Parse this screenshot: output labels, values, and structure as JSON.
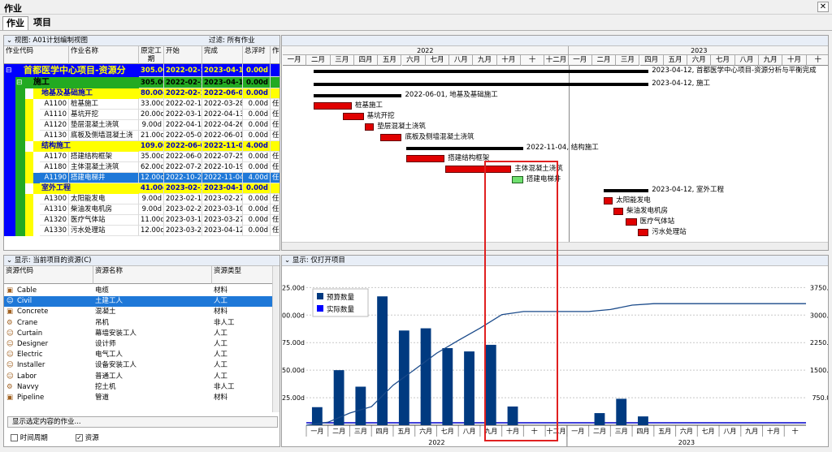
{
  "window": {
    "title": "作业",
    "close": "✕"
  },
  "tabs": [
    {
      "label": "作业"
    },
    {
      "label": "项目"
    }
  ],
  "activities": {
    "header": "视图: A01计划编制视图",
    "filter": "过滤: 所有作业",
    "columns": [
      "作业代码",
      "作业名称",
      "原定工期",
      "开始",
      "完成",
      "总浮时",
      "作"
    ],
    "rows": [
      {
        "kind": "project",
        "code": "首都医学中心项目-资源分",
        "name": "",
        "dur": "305.00d",
        "start": "2022-02-10",
        "finish": "2023-04-12",
        "float": "0.00d",
        "extra": ""
      },
      {
        "kind": "wbs1",
        "code": "",
        "name": "施工",
        "dur": "305.00d",
        "start": "2022-02-10",
        "finish": "2023-04-12",
        "float": "0.00d",
        "extra": ""
      },
      {
        "kind": "wbs2",
        "code": "",
        "name": "地基及基础施工",
        "dur": "80.00d",
        "start": "2022-02-10",
        "finish": "2022-06-01",
        "float": "0.00d",
        "extra": ""
      },
      {
        "kind": "task",
        "code": "A1100",
        "name": "桩基施工",
        "dur": "33.00d",
        "start": "2022-02-10",
        "finish": "2022-03-28",
        "float": "0.00d",
        "extra": "任:"
      },
      {
        "kind": "task",
        "code": "A1110",
        "name": "基坑开挖",
        "dur": "20.00d",
        "start": "2022-03-17",
        "finish": "2022-04-13",
        "float": "0.00d",
        "extra": "任:"
      },
      {
        "kind": "task",
        "code": "A1120",
        "name": "垫层混凝土浇筑",
        "dur": "9.00d",
        "start": "2022-04-14",
        "finish": "2022-04-26",
        "float": "0.00d",
        "extra": "任:"
      },
      {
        "kind": "task",
        "code": "A1130",
        "name": "底板及侧墙混凝土浇",
        "dur": "21.00d",
        "start": "2022-05-04",
        "finish": "2022-06-01",
        "float": "0.00d",
        "extra": "任:"
      },
      {
        "kind": "wbs2",
        "code": "",
        "name": "结构施工",
        "dur": "109.00d",
        "start": "2022-06-07",
        "finish": "2022-11-04",
        "float": "4.00d",
        "extra": ""
      },
      {
        "kind": "task",
        "code": "A1170",
        "name": "搭建结构框架",
        "dur": "35.00d",
        "start": "2022-06-07",
        "finish": "2022-07-25",
        "float": "0.00d",
        "extra": "任:"
      },
      {
        "kind": "task",
        "code": "A1180",
        "name": "主体混凝土浇筑",
        "dur": "62.00d",
        "start": "2022-07-26",
        "finish": "2022-10-19",
        "float": "0.00d",
        "extra": "任:"
      },
      {
        "kind": "selected",
        "code": "A1190",
        "name": "搭建电梯井",
        "dur": "12.00d",
        "start": "2022-10-20",
        "finish": "2022-11-04",
        "float": "4.00d",
        "extra": "任:"
      },
      {
        "kind": "wbs2",
        "code": "",
        "name": "室外工程",
        "dur": "41.00d",
        "start": "2023-02-15",
        "finish": "2023-04-12",
        "float": "0.00d",
        "extra": ""
      },
      {
        "kind": "task",
        "code": "A1300",
        "name": "太阳能发电",
        "dur": "9.00d",
        "start": "2023-02-15",
        "finish": "2023-02-27",
        "float": "0.00d",
        "extra": "任:"
      },
      {
        "kind": "task",
        "code": "A1310",
        "name": "柴油发电机房",
        "dur": "9.00d",
        "start": "2023-02-28",
        "finish": "2023-03-10",
        "float": "0.00d",
        "extra": "任:"
      },
      {
        "kind": "task",
        "code": "A1320",
        "name": "医疗气体站",
        "dur": "11.00d",
        "start": "2023-03-13",
        "finish": "2023-03-27",
        "float": "0.00d",
        "extra": "任:"
      },
      {
        "kind": "task",
        "code": "A1330",
        "name": "污水处理站",
        "dur": "12.00d",
        "start": "2023-03-28",
        "finish": "2023-04-12",
        "float": "0.00d",
        "extra": "任:"
      }
    ]
  },
  "gantt": {
    "years": [
      "2022",
      "2023"
    ],
    "months": [
      "一月",
      "二月",
      "三月",
      "四月",
      "五月",
      "六月",
      "七月",
      "八月",
      "九月",
      "十月",
      "十",
      "十二月",
      "一月",
      "二月",
      "三月",
      "四月",
      "五月",
      "六月",
      "七月",
      "八月",
      "九月",
      "十月",
      "十"
    ],
    "labels": [
      "2023-04-12, 首都医学中心项目-资源分析与平衡完成",
      "2023-04-12, 施工",
      "2022-06-01, 地基及基础施工",
      "桩基施工",
      "基坑开挖",
      "垫层混凝土浇筑",
      "底板及侧墙混凝土浇筑",
      "2022-11-04, 结构施工",
      "搭建结构框架",
      "主体混凝土浇筑",
      "搭建电梯井",
      "2023-04-12, 室外工程",
      "太阳能发电",
      "柴油发电机房",
      "医疗气体站",
      "污水处理站"
    ]
  },
  "resources": {
    "header": "显示: 当前项目的资源(C)",
    "columns": [
      "资源代码",
      "资源名称",
      "资源类型"
    ],
    "rows": [
      {
        "code": "Cable",
        "name": "电缆",
        "type": "材料",
        "icon": "material"
      },
      {
        "code": "Civil",
        "name": "土建工人",
        "type": "人工",
        "icon": "labor",
        "selected": true
      },
      {
        "code": "Concrete",
        "name": "混凝土",
        "type": "材料",
        "icon": "material"
      },
      {
        "code": "Crane",
        "name": "吊机",
        "type": "非人工",
        "icon": "equipment"
      },
      {
        "code": "Curtain",
        "name": "幕墙安装工人",
        "type": "人工",
        "icon": "labor"
      },
      {
        "code": "Designer",
        "name": "设计师",
        "type": "人工",
        "icon": "labor"
      },
      {
        "code": "Electric",
        "name": "电气工人",
        "type": "人工",
        "icon": "labor"
      },
      {
        "code": "Installer",
        "name": "设备安装工人",
        "type": "人工",
        "icon": "labor"
      },
      {
        "code": "Labor",
        "name": "普通工人",
        "type": "人工",
        "icon": "labor"
      },
      {
        "code": "Navvy",
        "name": "挖土机",
        "type": "非人工",
        "icon": "equipment"
      },
      {
        "code": "Pipeline",
        "name": "管道",
        "type": "材料",
        "icon": "material"
      }
    ],
    "show_selected": "显示选定内容的作业...",
    "opt_time": "时间周期",
    "opt_resource": "资源",
    "opt_time_checked": false,
    "opt_resource_checked": true
  },
  "histogram": {
    "header": "显示: 仅打开项目",
    "legend": [
      "预算数量",
      "实际数量"
    ],
    "left_ticks": [
      "625.00d",
      "500.00d",
      "375.00d",
      "250.00d",
      "125.00d"
    ],
    "right_ticks": [
      "3750.00d",
      "3000.00d",
      "2250.00d",
      "1500.00d",
      "750.00d"
    ],
    "months": [
      "一月",
      "二月",
      "三月",
      "四月",
      "五月",
      "六月",
      "七月",
      "八月",
      "九月",
      "十月",
      "十",
      "十二月",
      "一月",
      "二月",
      "三月",
      "四月",
      "五月",
      "六月",
      "七月",
      "八月",
      "九月",
      "十月",
      "十"
    ],
    "years": [
      "2022",
      "2023"
    ],
    "colors": {
      "bar": "#003a80",
      "curve": "#1a4a8a",
      "highlight": "#e02020"
    }
  },
  "chart_data": {
    "type": "bar",
    "categories": [
      "2022-01",
      "2022-02",
      "2022-03",
      "2022-04",
      "2022-05",
      "2022-06",
      "2022-07",
      "2022-08",
      "2022-09",
      "2022-10",
      "2022-11",
      "2022-12",
      "2023-01",
      "2023-02",
      "2023-03",
      "2023-04",
      "2023-05",
      "2023-06",
      "2023-07",
      "2023-08",
      "2023-09",
      "2023-10",
      "2023-11"
    ],
    "series": [
      {
        "name": "预算数量",
        "axis": "left",
        "values": [
          82,
          250,
          175,
          585,
          430,
          440,
          350,
          335,
          365,
          85,
          0,
          0,
          0,
          55,
          120,
          40,
          0,
          0,
          0,
          0,
          0,
          0,
          0
        ]
      },
      {
        "axis": "right",
        "type": "line",
        "values": [
          82,
          332,
          507,
          1092,
          1522,
          1962,
          2312,
          2647,
          3012,
          3097,
          3097,
          3097,
          3097,
          3152,
          3272,
          3312,
          3312,
          3312,
          3312,
          3312,
          3312,
          3312,
          3312
        ]
      }
    ],
    "ylim_left": [
      0,
      700
    ],
    "ylim_right": [
      0,
      4200
    ]
  }
}
